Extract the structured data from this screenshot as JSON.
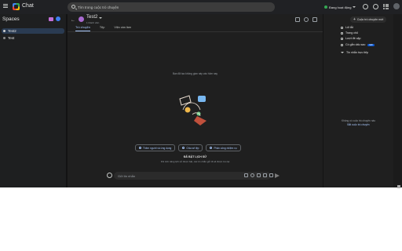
{
  "app": {
    "title": "Chat"
  },
  "search": {
    "placeholder": "Tìm trong cuộc trò chuyện"
  },
  "status": {
    "label": "Đang hoạt động",
    "color": "#34a853"
  },
  "header_icons": [
    "help-icon",
    "settings-icon",
    "apps-grid-icon",
    "account-avatar-icon"
  ],
  "sidebar": {
    "title": "Spaces",
    "items": [
      {
        "label": "Test2",
        "active": true
      },
      {
        "label": "Test",
        "active": false
      }
    ]
  },
  "chat": {
    "room_name": "Test2",
    "member_count": "1 thành viên",
    "tabs": [
      {
        "label": "Trò chuyện",
        "active": true
      },
      {
        "label": "Tệp",
        "active": false
      },
      {
        "label": "Việc cần làm",
        "active": false
      }
    ],
    "empty_text": "Bạn đã tạo không gian này vào hôm nay",
    "actions": [
      {
        "label": "Thêm người và ứng dụng",
        "icon": "add-person-icon"
      },
      {
        "label": "Chia sẻ tệp",
        "icon": "share-file-icon"
      },
      {
        "label": "Phân công nhiệm vụ",
        "icon": "assign-task-icon"
      }
    ],
    "history_title": "ĐÃ BẬT LỊCH SỬ",
    "history_note": "Khi tính năng lịch sử được bật, các tin nhắn gửi đi sẽ được lưu lại",
    "composer_placeholder": "Gửi tin nhắn"
  },
  "right_panel": {
    "new_chat_label": "Cuộc trò chuyện mới",
    "nav": [
      {
        "label": "Lối tắt",
        "icon": "shortcut-icon"
      },
      {
        "label": "Trang chủ",
        "icon": "home-icon"
      },
      {
        "label": "Lượt đề cập",
        "icon": "mention-icon"
      },
      {
        "label": "Có gắn dấu sao",
        "icon": "star-icon",
        "badge": "Mới"
      },
      {
        "label": "Tin nhắn trực tiếp",
        "icon": "direct-message-icon"
      }
    ],
    "empty_line1": "Không có cuộc trò chuyện nào",
    "empty_line2": "Bắt cuộc trò chuyện"
  },
  "colors": {
    "accent": "#a8c7fa",
    "background": "#131314",
    "panel": "#1f1f1f"
  }
}
